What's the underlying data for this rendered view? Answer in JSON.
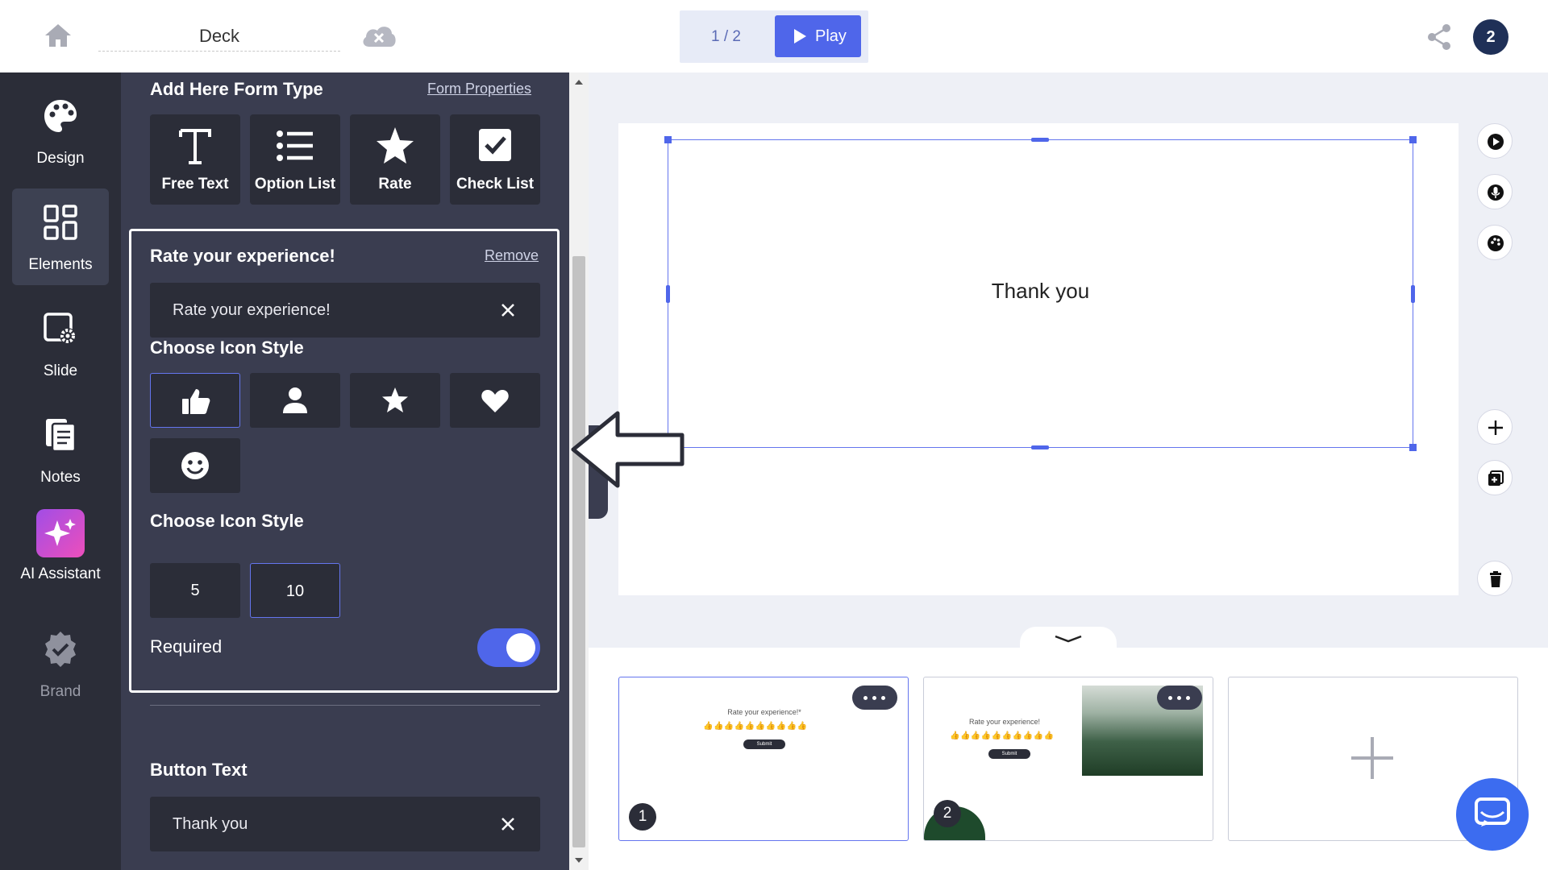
{
  "topbar": {
    "deck_name": "Deck",
    "page_indicator": "1 / 2",
    "play_label": "Play",
    "avatar_initial": "2"
  },
  "leftnav": {
    "items": [
      {
        "label": "Design",
        "icon": "palette-icon"
      },
      {
        "label": "Elements",
        "icon": "grid-icon"
      },
      {
        "label": "Slide",
        "icon": "slide-settings-icon"
      },
      {
        "label": "Notes",
        "icon": "notes-icon"
      },
      {
        "label": "AI Assistant",
        "icon": "sparkles-icon"
      },
      {
        "label": "Brand",
        "icon": "badge-check-icon"
      }
    ],
    "active": "Elements"
  },
  "panel": {
    "title": "Add Here Form Type",
    "properties_link": "Form Properties",
    "form_types": [
      {
        "label": "Free Text",
        "icon": "text-icon"
      },
      {
        "label": "Option List",
        "icon": "list-icon"
      },
      {
        "label": "Rate",
        "icon": "star-icon"
      },
      {
        "label": "Check List",
        "icon": "checkbox-icon"
      }
    ],
    "card": {
      "title": "Rate your experience!",
      "remove_link": "Remove",
      "question_value": "Rate your experience!",
      "icon_style_label": "Choose Icon Style",
      "icon_styles": [
        "thumbs-up-icon",
        "person-icon",
        "star-icon",
        "heart-icon",
        "smiley-icon"
      ],
      "selected_icon_style": "thumbs-up-icon",
      "count_label": "Choose Icon Style",
      "counts": [
        "5",
        "10"
      ],
      "selected_count": "10",
      "required_label": "Required",
      "required": true
    },
    "button_text_label": "Button Text",
    "button_text_value": "Thank you"
  },
  "canvas": {
    "text": "Thank you"
  },
  "thumbnails": [
    {
      "number": "1",
      "title": "Rate your experience!*",
      "icons": "👍👍👍👍👍👍👍👍👍👍",
      "submit": "Submit"
    },
    {
      "number": "2",
      "title": "Rate your experience!",
      "icons": "👍👍👍👍👍👍👍👍👍👍",
      "submit": "Submit"
    }
  ],
  "colors": {
    "accent": "#4f66ea",
    "panel": "#3a3d50",
    "nav": "#2b2d38"
  }
}
